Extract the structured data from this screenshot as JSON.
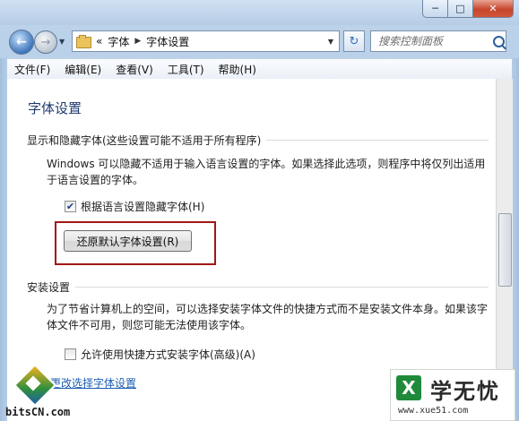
{
  "window": {
    "caption": {
      "minimize": "─",
      "maximize": "□",
      "close": "✕"
    }
  },
  "nav": {
    "back_icon": "←",
    "forward_icon": "→",
    "breadcrumb": [
      "«",
      "字体",
      "字体设置"
    ],
    "search_placeholder": "搜索控制面板",
    "refresh_icon": "↻"
  },
  "menu": [
    "文件(F)",
    "编辑(E)",
    "查看(V)",
    "工具(T)",
    "帮助(H)"
  ],
  "content": {
    "page_title": "字体设置",
    "section1": {
      "title": "显示和隐藏字体(这些设置可能不适用于所有程序)",
      "description": "Windows 可以隐藏不适用于输入语言设置的字体。如果选择此选项，则程序中将仅列出适用于语言设置的字体。",
      "checkbox_label": "根据语言设置隐藏字体(H)",
      "checkbox_checked": true,
      "button_label": "还原默认字体设置(R)"
    },
    "section2": {
      "title": "安装设置",
      "description": "为了节省计算机上的空间，可以选择安装字体文件的快捷方式而不是安装文件本身。如果该字体文件不可用，则您可能无法使用该字体。",
      "checkbox_label": "允许使用快捷方式安装字体(高级)(A)",
      "checkbox_checked": false
    },
    "link_text": "更改选择字体设置"
  },
  "watermarks": {
    "left_text": "bitsCN.com",
    "right_logo": "X",
    "right_brand": "学无忧",
    "right_url": "www.xue51.com"
  },
  "colors": {
    "accent": "#1e3a6e",
    "link": "#1f5fb3",
    "highlight": "#a11818"
  }
}
